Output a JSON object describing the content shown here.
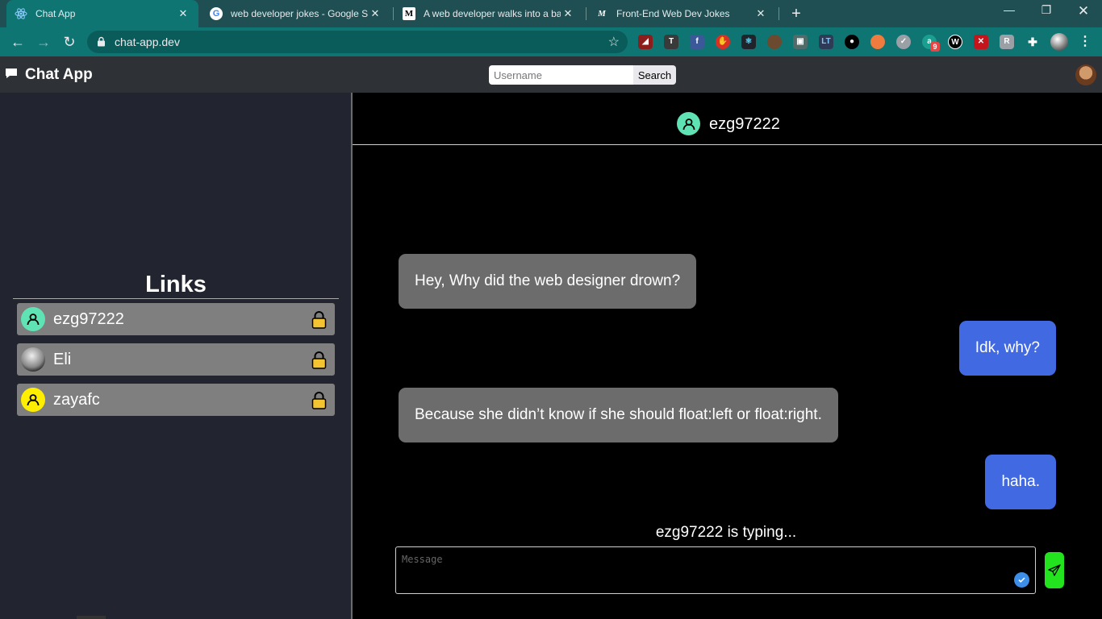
{
  "browser": {
    "tabs": [
      {
        "title": "Chat App",
        "favicon": "react-icon",
        "active": true
      },
      {
        "title": "web developer jokes - Google Se",
        "favicon": "google-icon",
        "active": false
      },
      {
        "title": "A web developer walks into a bar",
        "favicon": "medium-icon",
        "active": false
      },
      {
        "title": "Front-End Web Dev Jokes",
        "favicon": "medium-m-icon",
        "active": false
      }
    ],
    "url": "chat-app.dev",
    "extension_badge": "9"
  },
  "app": {
    "title": "Chat App",
    "search": {
      "placeholder": "Username",
      "button_label": "Search"
    }
  },
  "sidebar": {
    "title": "Links",
    "items": [
      {
        "name": "ezg97222",
        "avatar_color": "#5fe3b5",
        "locked": true
      },
      {
        "name": "Eli",
        "avatar_color": "#c9c9c9",
        "locked": true
      },
      {
        "name": "zayafc",
        "avatar_color": "#ffee00",
        "locked": true
      }
    ]
  },
  "chat": {
    "recipient": "ezg97222",
    "messages": [
      {
        "direction": "in",
        "text": "Hey, Why did the web designer drown?"
      },
      {
        "direction": "out",
        "text": "Idk, why?"
      },
      {
        "direction": "in",
        "text": "Because she didn’t know if she should float:left or float:right."
      },
      {
        "direction": "out",
        "text": "haha."
      }
    ],
    "typing_indicator": "ezg97222 is typing...",
    "input_placeholder": "Message"
  },
  "colors": {
    "incoming_bubble": "#6c6c6c",
    "outgoing_bubble": "#4169e1",
    "send_button": "#22e31e",
    "sidebar_bg": "#222530"
  }
}
